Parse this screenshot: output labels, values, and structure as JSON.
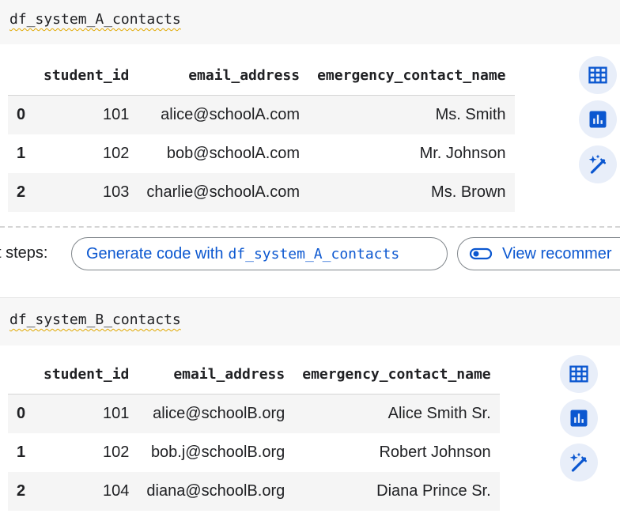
{
  "cell_a": {
    "code": "df_system_A_contacts",
    "columns": [
      "",
      "student_id",
      "email_address",
      "emergency_contact_name"
    ],
    "rows": [
      {
        "index": "0",
        "student_id": "101",
        "email_address": "alice@schoolA.com",
        "emergency_contact_name": "Ms. Smith"
      },
      {
        "index": "1",
        "student_id": "102",
        "email_address": "bob@schoolA.com",
        "emergency_contact_name": "Mr. Johnson"
      },
      {
        "index": "2",
        "student_id": "103",
        "email_address": "charlie@schoolA.com",
        "emergency_contact_name": "Ms. Brown"
      }
    ]
  },
  "next_steps": {
    "label": "xt steps:",
    "generate_prefix": "Generate code with",
    "generate_var": "df_system_A_contacts",
    "view_label": "View recommer"
  },
  "cell_b": {
    "code": "df_system_B_contacts",
    "columns": [
      "",
      "student_id",
      "email_address",
      "emergency_contact_name"
    ],
    "rows": [
      {
        "index": "0",
        "student_id": "101",
        "email_address": "alice@schoolB.org",
        "emergency_contact_name": "Alice Smith Sr."
      },
      {
        "index": "1",
        "student_id": "102",
        "email_address": "bob.j@schoolB.org",
        "emergency_contact_name": "Robert Johnson"
      },
      {
        "index": "2",
        "student_id": "104",
        "email_address": "diana@schoolB.org",
        "emergency_contact_name": "Diana Prince Sr."
      }
    ]
  },
  "icons": {
    "table": "table-icon",
    "chart": "bar-chart-icon",
    "magic": "magic-wand-icon",
    "toggle": "toggle-icon"
  },
  "colors": {
    "accent": "#0b57d0",
    "button_bg": "#e8eef9",
    "row_stripe": "#f5f5f5",
    "code_bg": "#f7f7f7"
  }
}
